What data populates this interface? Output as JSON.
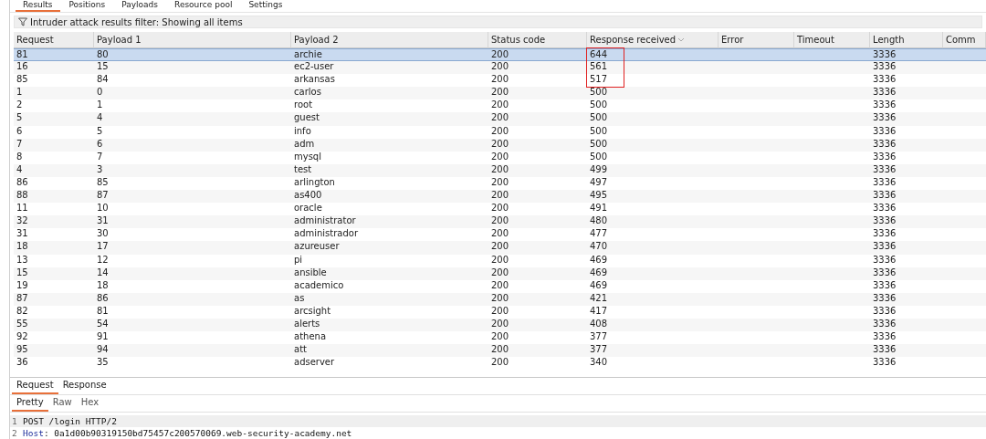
{
  "tabs": [
    {
      "label": "Results",
      "selected": true
    },
    {
      "label": "Positions",
      "selected": false
    },
    {
      "label": "Payloads",
      "selected": false
    },
    {
      "label": "Resource pool",
      "selected": false
    },
    {
      "label": "Settings",
      "selected": false
    }
  ],
  "filter": {
    "text": "Intruder attack results filter: Showing all items"
  },
  "table": {
    "columns": [
      {
        "label": "Request",
        "sorted": false
      },
      {
        "label": "Payload 1",
        "sorted": false
      },
      {
        "label": "Payload 2",
        "sorted": false
      },
      {
        "label": "Status code",
        "sorted": false
      },
      {
        "label": "Response received",
        "sorted": true
      },
      {
        "label": "Error",
        "sorted": false
      },
      {
        "label": "Timeout",
        "sorted": false
      },
      {
        "label": "Length",
        "sorted": false
      },
      {
        "label": "Comm",
        "sorted": false
      }
    ],
    "rows": [
      {
        "cells": [
          "81",
          "80",
          "archie",
          "200",
          "644",
          "",
          "",
          "3336"
        ],
        "selected": true,
        "boxed": true
      },
      {
        "cells": [
          "16",
          "15",
          "ec2-user",
          "200",
          "561",
          "",
          "",
          "3336"
        ],
        "selected": false,
        "boxed": true
      },
      {
        "cells": [
          "85",
          "84",
          "arkansas",
          "200",
          "517",
          "",
          "",
          "3336"
        ],
        "selected": false,
        "boxed": true
      },
      {
        "cells": [
          "1",
          "0",
          "carlos",
          "200",
          "500",
          "",
          "",
          "3336"
        ],
        "selected": false,
        "boxed": false
      },
      {
        "cells": [
          "2",
          "1",
          "root",
          "200",
          "500",
          "",
          "",
          "3336"
        ],
        "selected": false,
        "boxed": false
      },
      {
        "cells": [
          "5",
          "4",
          "guest",
          "200",
          "500",
          "",
          "",
          "3336"
        ],
        "selected": false,
        "boxed": false
      },
      {
        "cells": [
          "6",
          "5",
          "info",
          "200",
          "500",
          "",
          "",
          "3336"
        ],
        "selected": false,
        "boxed": false
      },
      {
        "cells": [
          "7",
          "6",
          "adm",
          "200",
          "500",
          "",
          "",
          "3336"
        ],
        "selected": false,
        "boxed": false
      },
      {
        "cells": [
          "8",
          "7",
          "mysql",
          "200",
          "500",
          "",
          "",
          "3336"
        ],
        "selected": false,
        "boxed": false
      },
      {
        "cells": [
          "4",
          "3",
          "test",
          "200",
          "499",
          "",
          "",
          "3336"
        ],
        "selected": false,
        "boxed": false
      },
      {
        "cells": [
          "86",
          "85",
          "arlington",
          "200",
          "497",
          "",
          "",
          "3336"
        ],
        "selected": false,
        "boxed": false
      },
      {
        "cells": [
          "88",
          "87",
          "as400",
          "200",
          "495",
          "",
          "",
          "3336"
        ],
        "selected": false,
        "boxed": false
      },
      {
        "cells": [
          "11",
          "10",
          "oracle",
          "200",
          "491",
          "",
          "",
          "3336"
        ],
        "selected": false,
        "boxed": false
      },
      {
        "cells": [
          "32",
          "31",
          "administrator",
          "200",
          "480",
          "",
          "",
          "3336"
        ],
        "selected": false,
        "boxed": false
      },
      {
        "cells": [
          "31",
          "30",
          "administrador",
          "200",
          "477",
          "",
          "",
          "3336"
        ],
        "selected": false,
        "boxed": false
      },
      {
        "cells": [
          "18",
          "17",
          "azureuser",
          "200",
          "470",
          "",
          "",
          "3336"
        ],
        "selected": false,
        "boxed": false
      },
      {
        "cells": [
          "13",
          "12",
          "pi",
          "200",
          "469",
          "",
          "",
          "3336"
        ],
        "selected": false,
        "boxed": false
      },
      {
        "cells": [
          "15",
          "14",
          "ansible",
          "200",
          "469",
          "",
          "",
          "3336"
        ],
        "selected": false,
        "boxed": false
      },
      {
        "cells": [
          "19",
          "18",
          "academico",
          "200",
          "469",
          "",
          "",
          "3336"
        ],
        "selected": false,
        "boxed": false
      },
      {
        "cells": [
          "87",
          "86",
          "as",
          "200",
          "421",
          "",
          "",
          "3336"
        ],
        "selected": false,
        "boxed": false
      },
      {
        "cells": [
          "82",
          "81",
          "arcsight",
          "200",
          "417",
          "",
          "",
          "3336"
        ],
        "selected": false,
        "boxed": false
      },
      {
        "cells": [
          "55",
          "54",
          "alerts",
          "200",
          "408",
          "",
          "",
          "3336"
        ],
        "selected": false,
        "boxed": false
      },
      {
        "cells": [
          "92",
          "91",
          "athena",
          "200",
          "377",
          "",
          "",
          "3336"
        ],
        "selected": false,
        "boxed": false
      },
      {
        "cells": [
          "95",
          "94",
          "att",
          "200",
          "377",
          "",
          "",
          "3336"
        ],
        "selected": false,
        "boxed": false
      },
      {
        "cells": [
          "36",
          "35",
          "adserver",
          "200",
          "340",
          "",
          "",
          "3336"
        ],
        "selected": false,
        "boxed": false
      }
    ]
  },
  "message_tabs": [
    {
      "label": "Request",
      "selected": true
    },
    {
      "label": "Response",
      "selected": false
    }
  ],
  "view_tabs": [
    {
      "label": "Pretty",
      "selected": true
    },
    {
      "label": "Raw",
      "selected": false
    },
    {
      "label": "Hex",
      "selected": false
    }
  ],
  "editor": {
    "lines": [
      {
        "number": "1",
        "parts": [
          {
            "kind": "plain",
            "text": "POST /login HTTP/2"
          }
        ],
        "current": true
      },
      {
        "number": "2",
        "parts": [
          {
            "kind": "header",
            "text": "Host"
          },
          {
            "kind": "plain",
            "text": ": 0a1d00b90319150bd75457c200570069.web-security-academy.net"
          }
        ],
        "current": false
      }
    ]
  }
}
